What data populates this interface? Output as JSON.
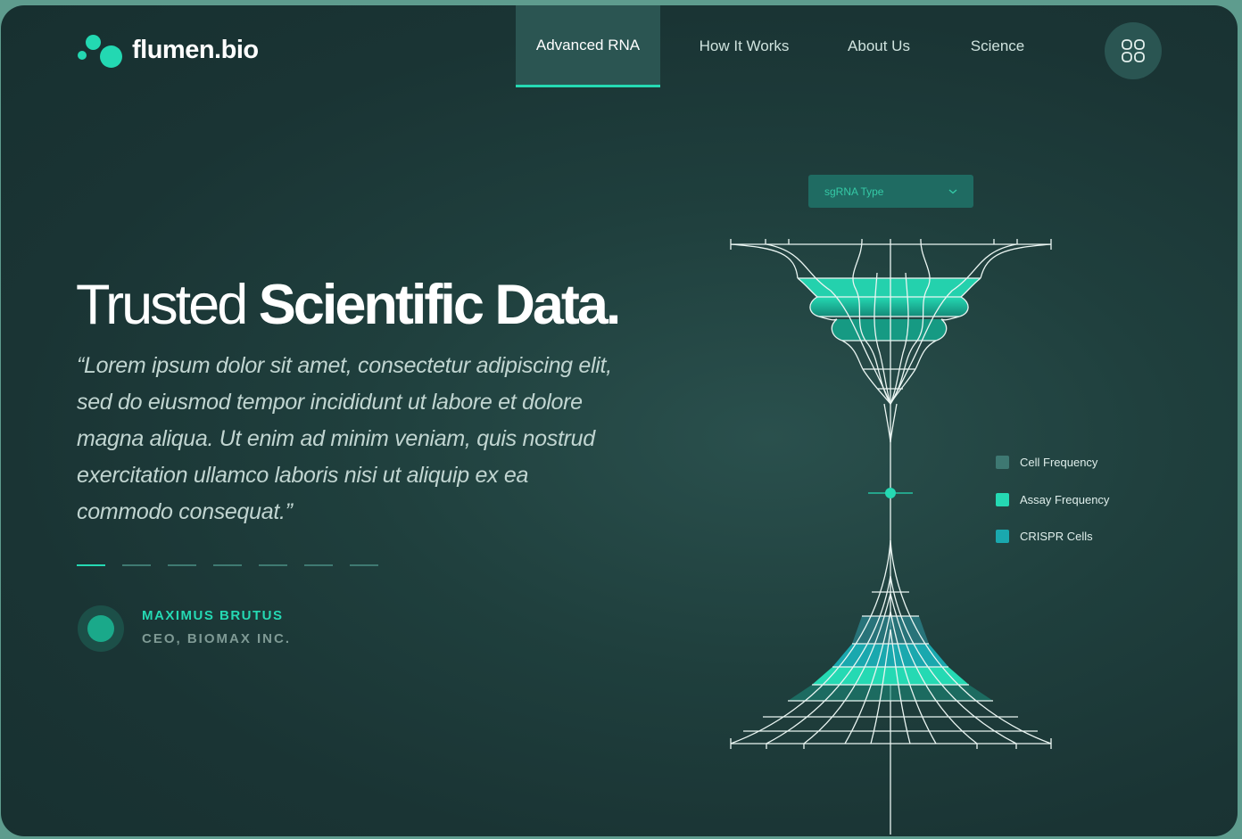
{
  "brand": {
    "name": "flumen.bio"
  },
  "nav": {
    "items": [
      {
        "label": "Advanced RNA",
        "active": true
      },
      {
        "label": "How It Works",
        "active": false
      },
      {
        "label": "About Us",
        "active": false
      },
      {
        "label": "Science",
        "active": false
      }
    ],
    "menu_icon": "grid-icon"
  },
  "hero": {
    "title_light": "Trusted",
    "title_bold": "Scientific Data.",
    "quote": "“Lorem ipsum dolor sit amet, consectetur adipiscing elit, sed do eiusmod tempor incididunt ut labore et dolore magna aliqua. Ut enim ad minim veniam, quis nostrud exercitation ullamco laboris nisi ut aliquip ex ea commodo consequat.”",
    "carousel": {
      "total": 7,
      "active_index": 0
    }
  },
  "author": {
    "name": "MAXIMUS BRUTUS",
    "role": "CEO, BIOMAX INC."
  },
  "chart": {
    "dropdown_label": "sgRNA Type",
    "dropdown_icon": "chevron-down-icon",
    "legend": [
      {
        "label": "Cell Frequency",
        "color": "#3e7872"
      },
      {
        "label": "Assay Frequency",
        "color": "#25d9b3"
      },
      {
        "label": "CRISPR Cells",
        "color": "#1aa8ae"
      }
    ]
  },
  "colors": {
    "accent": "#25d9b3",
    "background": "#1d3a39",
    "nav_active": "#2b5552"
  }
}
